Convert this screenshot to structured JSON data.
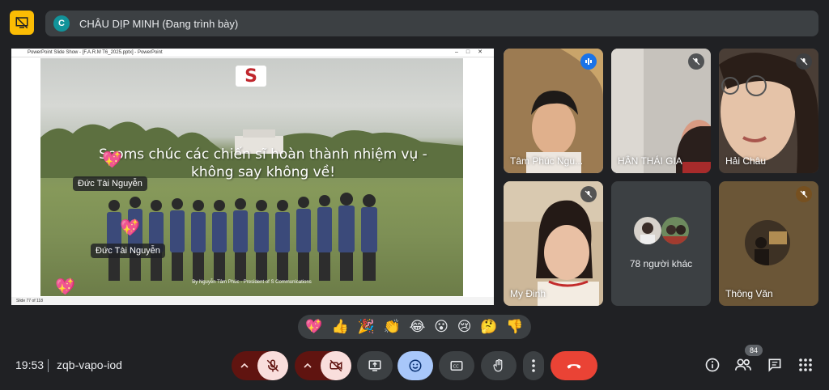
{
  "presenter": {
    "initial": "C",
    "label": "CHÂU DỊP MINH (Đang trình bày)"
  },
  "presentation": {
    "window_title": "PowerPoint Slide Show - [F.A.R.M T6_2025.pptx] - PowerPoint",
    "logo_letter": "S",
    "headline_1": "Scoms chúc các chiến sĩ hoàn thành nhiệm vụ -",
    "headline_2": "không say không về!",
    "credit": "By Nguyễn Tâm Phúc - President of S Communications",
    "slide_counter": "Slide 77 of 118",
    "reaction_name_1": "Đức Tài Nguyễn",
    "reaction_name_2": "Đức Tài Nguyễn"
  },
  "participants": [
    {
      "name": "Tâm Phúc Ngu...",
      "mic": "speaking",
      "bg": "#8a6d4c"
    },
    {
      "name": "HÂN THÁI GIA",
      "mic": "muted",
      "bg": "#b9b4ae"
    },
    {
      "name": "Hải Châu",
      "mic": "muted",
      "bg": "#4b4039"
    },
    {
      "name": "My Đinh",
      "mic": "muted",
      "bg": "#c7b497"
    },
    {
      "name": "78 người khác",
      "mic": "none",
      "bg": "#3c4043"
    },
    {
      "name": "Thông Văn",
      "mic": "muted-orange",
      "bg": "#6b5637"
    }
  ],
  "reactions": [
    "💖",
    "👍",
    "🎉",
    "👏",
    "😂",
    "😮",
    "😢",
    "🤔",
    "👎"
  ],
  "bottom": {
    "time": "19:53",
    "meeting_code": "zqb-vapo-iod",
    "people_count": "84"
  },
  "colors": {
    "accent_blue": "#8ab4f8",
    "hangup_red": "#ea4335",
    "muted_red": "#f9dedc",
    "yellow": "#fbbc04"
  }
}
